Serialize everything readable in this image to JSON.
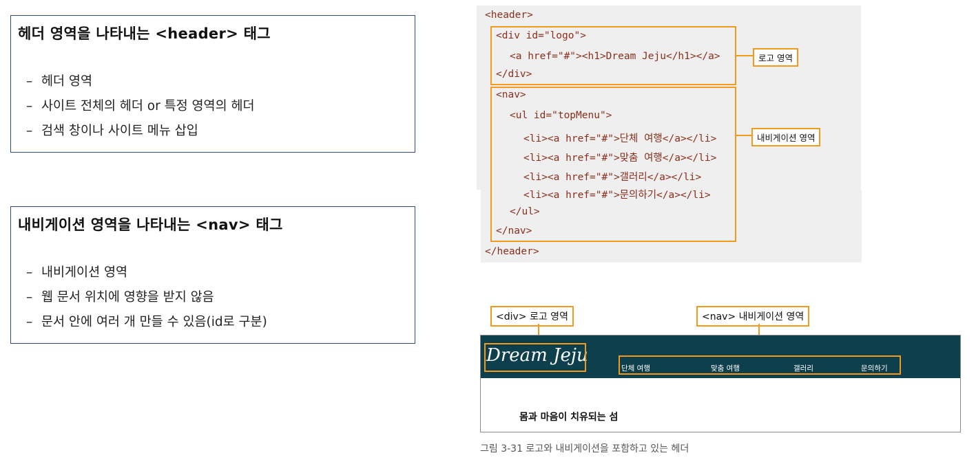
{
  "header_box": {
    "title": "헤더 영역을 나타내는 <header> 태그",
    "items": [
      "헤더 영역",
      "사이트 전체의 헤더 or 특정 영역의 헤더",
      "검색 창이나 사이트 메뉴 삽입"
    ],
    "bullet": "–"
  },
  "nav_box": {
    "title": "내비게이션 영역을 나타내는 <nav> 태그",
    "items": [
      "내비게이션 영역",
      "웹 문서 위치에 영향을 받지 않음",
      "문서 안에 여러 개 만들 수 있음(id로 구분)"
    ],
    "bullet": "–"
  },
  "code": {
    "lines": [
      "<header>",
      "<div id=\"logo\">",
      "<a href=\"#\"><h1>Dream Jeju</h1></a>",
      "</div>",
      "<nav>",
      "<ul id=\"topMenu\">",
      "<li><a href=\"#\">단체 여행</a></li>",
      "<li><a href=\"#\">맞춤 여행</a></li>",
      "<li><a href=\"#\">갤러리</a></li>",
      "<li><a href=\"#\">문의하기</a></li>",
      "</ul>",
      "</nav>",
      "</header>"
    ],
    "logo_label": "로고 영역",
    "nav_label": "내비게이션 영역"
  },
  "preview": {
    "logo_label": "<div> 로고 영역",
    "nav_label": "<nav> 내비게이션 영역",
    "logo_text": "Dream Jeju",
    "menu": [
      "단체 여행",
      "맞춤 여행",
      "갤러리",
      "문의하기"
    ],
    "tagline": "몸과 마음이 치유되는 섬",
    "bar_color": "#0e3f4c",
    "accent_color": "#f39a1e"
  },
  "caption": "그림 3-31  로고와 내비게이션을 포함하고 있는 헤더"
}
